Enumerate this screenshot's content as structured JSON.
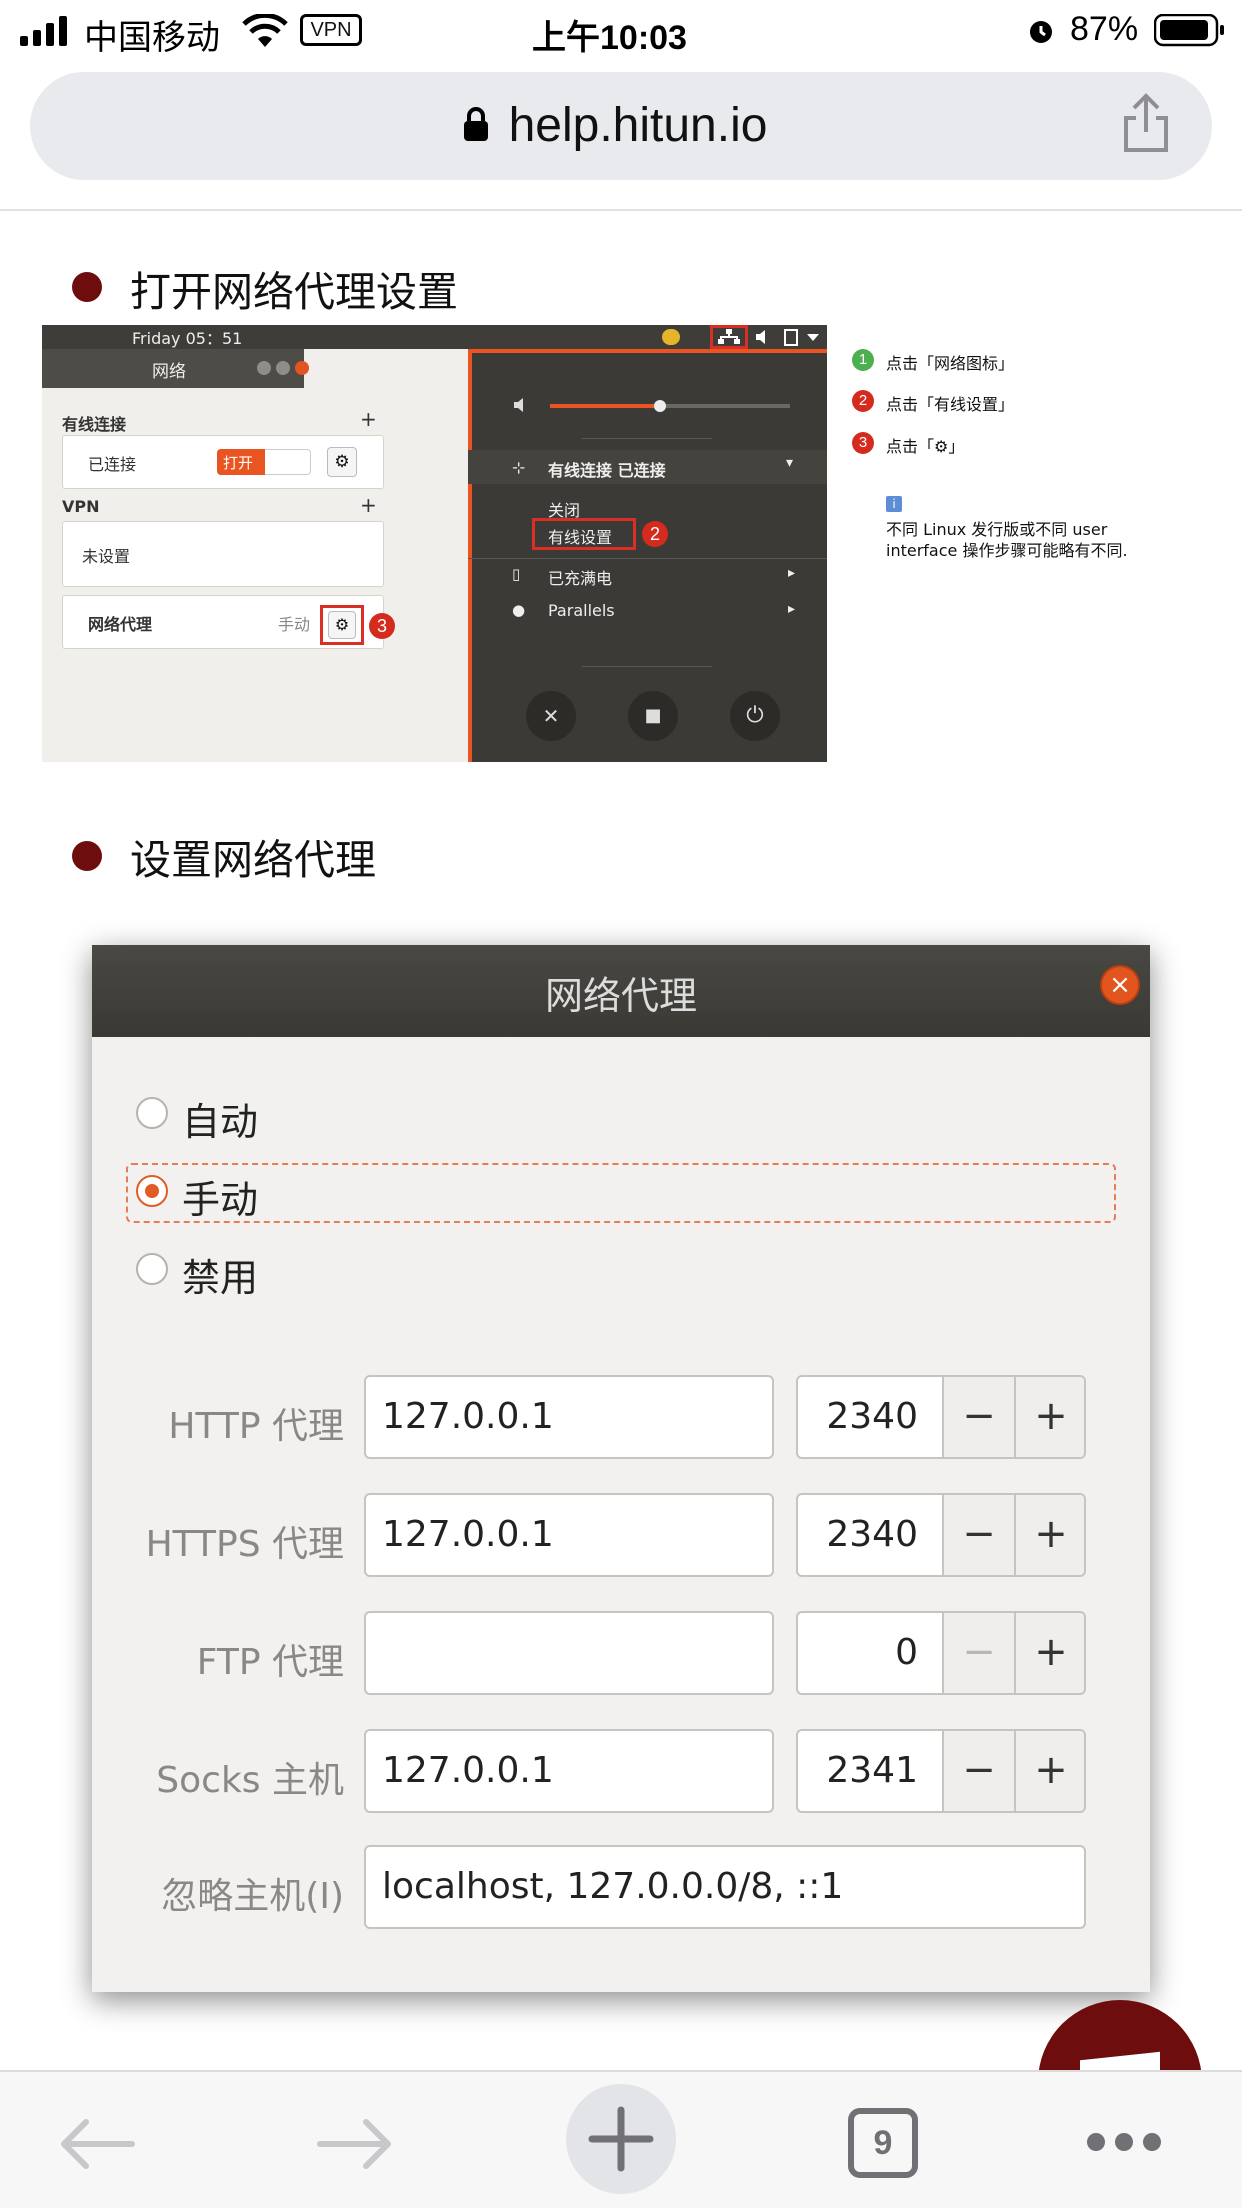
{
  "status_bar": {
    "carrier": "中国移动",
    "vpn": "VPN",
    "time": "上午10:03",
    "battery_pct": "87%"
  },
  "browser": {
    "url": "help.hitun.io",
    "tab_count": "9"
  },
  "sections": [
    {
      "heading": "打开网络代理设置"
    },
    {
      "heading": "设置网络代理"
    }
  ],
  "screenshot1": {
    "topbar_clock": "Friday 05：51",
    "window_title": "网络",
    "wired_header": "有线连接",
    "wired_status": "已连接",
    "toggle_label": "打开",
    "vpn_header": "VPN",
    "vpn_status": "未设置",
    "proxy_label": "网络代理",
    "proxy_mode": "手动",
    "menu": {
      "wired": "有线连接 已连接",
      "close": "关闭",
      "wired_settings": "有线设置",
      "battery": "已充满电",
      "parallels": "Parallels"
    },
    "badges": [
      "1",
      "2",
      "3"
    ]
  },
  "legend": {
    "step1": "点击「网络图标」",
    "step2": "点击「有线设置」",
    "step3": "点击「⚙」",
    "note_line1": "不同 Linux 发行版或不同 user",
    "note_line2": "interface 操作步骤可能略有不同."
  },
  "proxy_dialog": {
    "title": "网络代理",
    "close_glyph": "×",
    "modes": [
      "自动",
      "手动",
      "禁用"
    ],
    "selected_mode": "手动",
    "rows": [
      {
        "label": "HTTP 代理",
        "host": "127.0.0.1",
        "port": "2340"
      },
      {
        "label": "HTTPS 代理",
        "host": "127.0.0.1",
        "port": "2340"
      },
      {
        "label": "FTP 代理",
        "host": "",
        "port": "0"
      },
      {
        "label": "Socks 主机",
        "host": "127.0.0.1",
        "port": "2341"
      }
    ],
    "ignore_label": "忽略主机(I)",
    "ignore_value": "localhost, 127.0.0.0/8, ::1",
    "minus": "−",
    "plus": "+"
  }
}
